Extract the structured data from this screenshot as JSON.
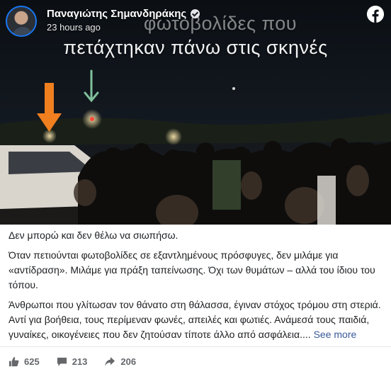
{
  "post": {
    "author": "Παναγιώτης Σημανδηράκης",
    "time": "23 hours ago",
    "overlay_line1": "φωτοβολίδες που",
    "overlay_line2": "πετάχτηκαν πάνω στις σκηνές",
    "paragraphs": [
      "Δεν μπορώ και δεν θέλω να σιωπήσω.",
      "Όταν πετιούνται φωτοβολίδες σε εξαντλημένους πρόσφυγες, δεν μιλάμε για «αντίδραση». Μιλάμε για πράξη ταπείνωσης. Όχι των θυμάτων – αλλά του ίδιου του τόπου.",
      "Άνθρωποι που γλίτωσαν τον θάνατο στη θάλασσα, έγιναν στόχος τρόμου στη στεριά. Αντί για βοήθεια, τους περίμεναν φωνές, απειλές και φωτιές. Ανάμεσά τους παιδιά, γυναίκες, οικογένειες που δεν ζητούσαν τίποτε άλλο από ασφάλεια...."
    ],
    "see_more": "See more"
  },
  "stats": {
    "likes": "625",
    "comments": "213",
    "shares": "206"
  },
  "icons": {
    "logo": "facebook-logo-icon",
    "verified": "verified-badge-icon",
    "like": "thumbs-up-icon",
    "comment": "comment-bubble-icon",
    "share": "share-arrow-icon"
  },
  "colors": {
    "link": "#385898",
    "verified_ring": "#1877f2",
    "arrow_orange": "#f07f1f",
    "arrow_green": "#7fbf9a"
  }
}
